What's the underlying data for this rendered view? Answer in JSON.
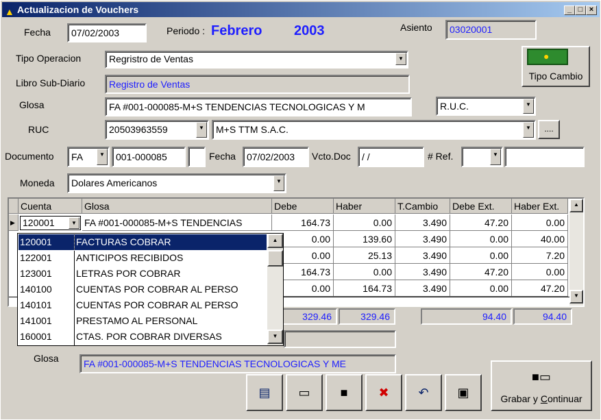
{
  "window": {
    "title": "Actualizacion de Vouchers"
  },
  "header": {
    "fecha_label": "Fecha",
    "fecha_value": "07/02/2003",
    "periodo_label": "Periodo :",
    "periodo_month": "Febrero",
    "periodo_year": "2003",
    "asiento_label": "Asiento",
    "asiento_value": "03020001"
  },
  "form": {
    "tipo_operacion_label": "Tipo Operacion",
    "tipo_operacion_value": "Regristro de Ventas",
    "libro_label": "Libro Sub-Diario",
    "libro_value": "Registro de Ventas",
    "tipo_cambio_button": "Tipo Cambio",
    "glosa_label": "Glosa",
    "glosa_value": "FA #001-000085-M+S TENDENCIAS TECNOLOGICAS Y M",
    "ruc_type_value": "R.U.C.",
    "ruc_label": "RUC",
    "ruc_value": "20503963559",
    "ruc_name": "M+S TTM S.A.C.",
    "ellipsis_button": "....",
    "documento_label": "Documento",
    "documento_type": "FA",
    "documento_number": "001-000085",
    "fecha2_label": "Fecha",
    "fecha2_value": "07/02/2003",
    "vcto_label": "Vcto.Doc",
    "vcto_value": " / /",
    "ref_label": "# Ref.",
    "moneda_label": "Moneda",
    "moneda_value": "Dolares Americanos"
  },
  "grid": {
    "headers": [
      "Cuenta",
      "Glosa",
      "Debe",
      "Haber",
      "T.Cambio",
      "Debe Ext.",
      "Haber Ext."
    ],
    "current_cuenta": "120001",
    "current_glosa": "FA #001-000085-M+S TENDENCIAS",
    "rows": [
      {
        "debe": "164.73",
        "haber": "0.00",
        "tc": "3.490",
        "debe_ext": "47.20",
        "haber_ext": "0.00"
      },
      {
        "debe": "0.00",
        "haber": "139.60",
        "tc": "3.490",
        "debe_ext": "0.00",
        "haber_ext": "40.00"
      },
      {
        "debe": "0.00",
        "haber": "25.13",
        "tc": "3.490",
        "debe_ext": "0.00",
        "haber_ext": "7.20"
      },
      {
        "debe": "164.73",
        "haber": "0.00",
        "tc": "3.490",
        "debe_ext": "47.20",
        "haber_ext": "0.00"
      },
      {
        "debe": "0.00",
        "haber": "164.73",
        "tc": "3.490",
        "debe_ext": "0.00",
        "haber_ext": "47.20"
      }
    ],
    "totals": {
      "debe": "329.46",
      "haber": "329.46",
      "debe_ext": "94.40",
      "haber_ext": "94.40"
    }
  },
  "dropdown_list": [
    {
      "code": "120001",
      "name": "FACTURAS COBRAR"
    },
    {
      "code": "122001",
      "name": "ANTICIPOS RECIBIDOS"
    },
    {
      "code": "123001",
      "name": "LETRAS POR COBRAR"
    },
    {
      "code": "140100",
      "name": "CUENTAS POR COBRAR AL PERSO"
    },
    {
      "code": "140101",
      "name": "CUENTAS POR COBRAR AL PERSO"
    },
    {
      "code": "141001",
      "name": "PRESTAMO AL PERSONAL"
    },
    {
      "code": "160001",
      "name": "CTAS. POR COBRAR DIVERSAS"
    }
  ],
  "footer": {
    "glosa_label": "Glosa",
    "glosa_value": "FA #001-000085-M+S TENDENCIAS TECNOLOGICAS Y ME",
    "grabar_label_pre": "Grabar y ",
    "grabar_label_acc": "C",
    "grabar_label_post": "ontinuar"
  },
  "colors": {
    "titlebar": "#0a246a",
    "accent_text": "#1e1eff",
    "selection": "#0a246a"
  }
}
